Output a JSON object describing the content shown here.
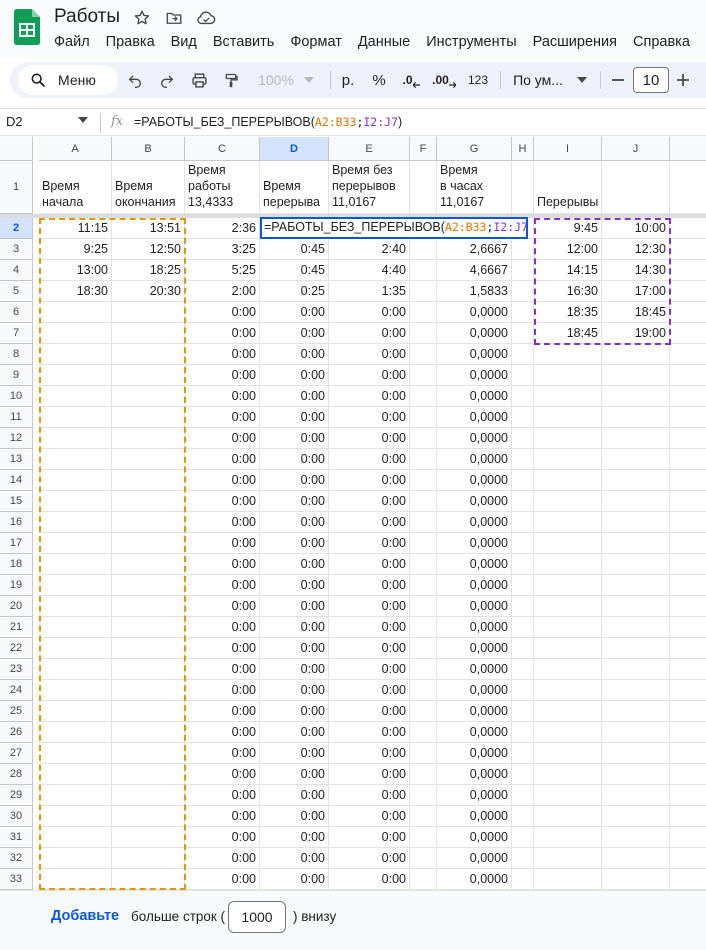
{
  "document": {
    "title": "Работы"
  },
  "menu": [
    "Файл",
    "Правка",
    "Вид",
    "Вставить",
    "Формат",
    "Данные",
    "Инструменты",
    "Расширения",
    "Справка"
  ],
  "toolbar": {
    "menu_label": "Меню",
    "zoom": "100%",
    "currency": "р.",
    "percent": "%",
    "dec_decrease": ".0",
    "dec_increase": ".00",
    "number_format": "123",
    "font_name": "По ум...",
    "font_size": "10"
  },
  "formula_bar": {
    "cell_ref": "D2",
    "fx_symbol": "fx",
    "formula_prefix": "=РАБОТЫ_БЕЗ_ПЕРЕРЫВОВ(",
    "range1": "A2:B33",
    "separator": ";",
    "range2": "I2:J7",
    "formula_suffix": ")"
  },
  "sheet": {
    "columns": [
      "A",
      "B",
      "C",
      "D",
      "E",
      "F",
      "G",
      "H",
      "I",
      "J"
    ],
    "selected_column": "D",
    "selected_row": "2",
    "header_row": {
      "A": "Время\nначала",
      "B": "Время\nокончания",
      "C": "Время\nработы\n13,4333",
      "D": "Время\nперерыва",
      "E": "Время без\nперерывов\n11,0167",
      "F": "",
      "G": "Время\n в часах\n11,0167",
      "H": "",
      "I": "Перерывы",
      "J": ""
    },
    "rows": [
      {
        "n": "2",
        "A": "11:15",
        "B": "13:51",
        "C": "2:36",
        "D": "",
        "E": "",
        "G": "",
        "I": "9:45",
        "J": "10:00"
      },
      {
        "n": "3",
        "A": "9:25",
        "B": "12:50",
        "C": "3:25",
        "D": "0:45",
        "E": "2:40",
        "G": "2,6667",
        "I": "12:00",
        "J": "12:30"
      },
      {
        "n": "4",
        "A": "13:00",
        "B": "18:25",
        "C": "5:25",
        "D": "0:45",
        "E": "4:40",
        "G": "4,6667",
        "I": "14:15",
        "J": "14:30"
      },
      {
        "n": "5",
        "A": "18:30",
        "B": "20:30",
        "C": "2:00",
        "D": "0:25",
        "E": "1:35",
        "G": "1,5833",
        "I": "16:30",
        "J": "17:00"
      },
      {
        "n": "6",
        "A": "",
        "B": "",
        "C": "0:00",
        "D": "0:00",
        "E": "0:00",
        "G": "0,0000",
        "I": "18:35",
        "J": "18:45"
      },
      {
        "n": "7",
        "A": "",
        "B": "",
        "C": "0:00",
        "D": "0:00",
        "E": "0:00",
        "G": "0,0000",
        "I": "18:45",
        "J": "19:00"
      },
      {
        "n": "8",
        "A": "",
        "B": "",
        "C": "0:00",
        "D": "0:00",
        "E": "0:00",
        "G": "0,0000",
        "I": "",
        "J": ""
      },
      {
        "n": "9",
        "A": "",
        "B": "",
        "C": "0:00",
        "D": "0:00",
        "E": "0:00",
        "G": "0,0000",
        "I": "",
        "J": ""
      },
      {
        "n": "10",
        "A": "",
        "B": "",
        "C": "0:00",
        "D": "0:00",
        "E": "0:00",
        "G": "0,0000",
        "I": "",
        "J": ""
      },
      {
        "n": "11",
        "A": "",
        "B": "",
        "C": "0:00",
        "D": "0:00",
        "E": "0:00",
        "G": "0,0000",
        "I": "",
        "J": ""
      },
      {
        "n": "12",
        "A": "",
        "B": "",
        "C": "0:00",
        "D": "0:00",
        "E": "0:00",
        "G": "0,0000",
        "I": "",
        "J": ""
      },
      {
        "n": "13",
        "A": "",
        "B": "",
        "C": "0:00",
        "D": "0:00",
        "E": "0:00",
        "G": "0,0000",
        "I": "",
        "J": ""
      },
      {
        "n": "14",
        "A": "",
        "B": "",
        "C": "0:00",
        "D": "0:00",
        "E": "0:00",
        "G": "0,0000",
        "I": "",
        "J": ""
      },
      {
        "n": "15",
        "A": "",
        "B": "",
        "C": "0:00",
        "D": "0:00",
        "E": "0:00",
        "G": "0,0000",
        "I": "",
        "J": ""
      },
      {
        "n": "16",
        "A": "",
        "B": "",
        "C": "0:00",
        "D": "0:00",
        "E": "0:00",
        "G": "0,0000",
        "I": "",
        "J": ""
      },
      {
        "n": "17",
        "A": "",
        "B": "",
        "C": "0:00",
        "D": "0:00",
        "E": "0:00",
        "G": "0,0000",
        "I": "",
        "J": ""
      },
      {
        "n": "18",
        "A": "",
        "B": "",
        "C": "0:00",
        "D": "0:00",
        "E": "0:00",
        "G": "0,0000",
        "I": "",
        "J": ""
      },
      {
        "n": "19",
        "A": "",
        "B": "",
        "C": "0:00",
        "D": "0:00",
        "E": "0:00",
        "G": "0,0000",
        "I": "",
        "J": ""
      },
      {
        "n": "20",
        "A": "",
        "B": "",
        "C": "0:00",
        "D": "0:00",
        "E": "0:00",
        "G": "0,0000",
        "I": "",
        "J": ""
      },
      {
        "n": "21",
        "A": "",
        "B": "",
        "C": "0:00",
        "D": "0:00",
        "E": "0:00",
        "G": "0,0000",
        "I": "",
        "J": ""
      },
      {
        "n": "22",
        "A": "",
        "B": "",
        "C": "0:00",
        "D": "0:00",
        "E": "0:00",
        "G": "0,0000",
        "I": "",
        "J": ""
      },
      {
        "n": "23",
        "A": "",
        "B": "",
        "C": "0:00",
        "D": "0:00",
        "E": "0:00",
        "G": "0,0000",
        "I": "",
        "J": ""
      },
      {
        "n": "24",
        "A": "",
        "B": "",
        "C": "0:00",
        "D": "0:00",
        "E": "0:00",
        "G": "0,0000",
        "I": "",
        "J": ""
      },
      {
        "n": "25",
        "A": "",
        "B": "",
        "C": "0:00",
        "D": "0:00",
        "E": "0:00",
        "G": "0,0000",
        "I": "",
        "J": ""
      },
      {
        "n": "26",
        "A": "",
        "B": "",
        "C": "0:00",
        "D": "0:00",
        "E": "0:00",
        "G": "0,0000",
        "I": "",
        "J": ""
      },
      {
        "n": "27",
        "A": "",
        "B": "",
        "C": "0:00",
        "D": "0:00",
        "E": "0:00",
        "G": "0,0000",
        "I": "",
        "J": ""
      },
      {
        "n": "28",
        "A": "",
        "B": "",
        "C": "0:00",
        "D": "0:00",
        "E": "0:00",
        "G": "0,0000",
        "I": "",
        "J": ""
      },
      {
        "n": "29",
        "A": "",
        "B": "",
        "C": "0:00",
        "D": "0:00",
        "E": "0:00",
        "G": "0,0000",
        "I": "",
        "J": ""
      },
      {
        "n": "30",
        "A": "",
        "B": "",
        "C": "0:00",
        "D": "0:00",
        "E": "0:00",
        "G": "0,0000",
        "I": "",
        "J": ""
      },
      {
        "n": "31",
        "A": "",
        "B": "",
        "C": "0:00",
        "D": "0:00",
        "E": "0:00",
        "G": "0,0000",
        "I": "",
        "J": ""
      },
      {
        "n": "32",
        "A": "",
        "B": "",
        "C": "0:00",
        "D": "0:00",
        "E": "0:00",
        "G": "0,0000",
        "I": "",
        "J": ""
      },
      {
        "n": "33",
        "A": "",
        "B": "",
        "C": "0:00",
        "D": "0:00",
        "E": "0:00",
        "G": "0,0000",
        "I": "",
        "J": ""
      }
    ]
  },
  "footer": {
    "add_label": "Добавьте",
    "more_rows_label": "больше строк (",
    "rows_value": "1000",
    "below_label": ") внизу"
  },
  "colors": {
    "accent": "#0b57d0",
    "range1_highlight": "#e69500",
    "range2_highlight": "#8430ce",
    "sheets_green": "#0f9d58"
  }
}
